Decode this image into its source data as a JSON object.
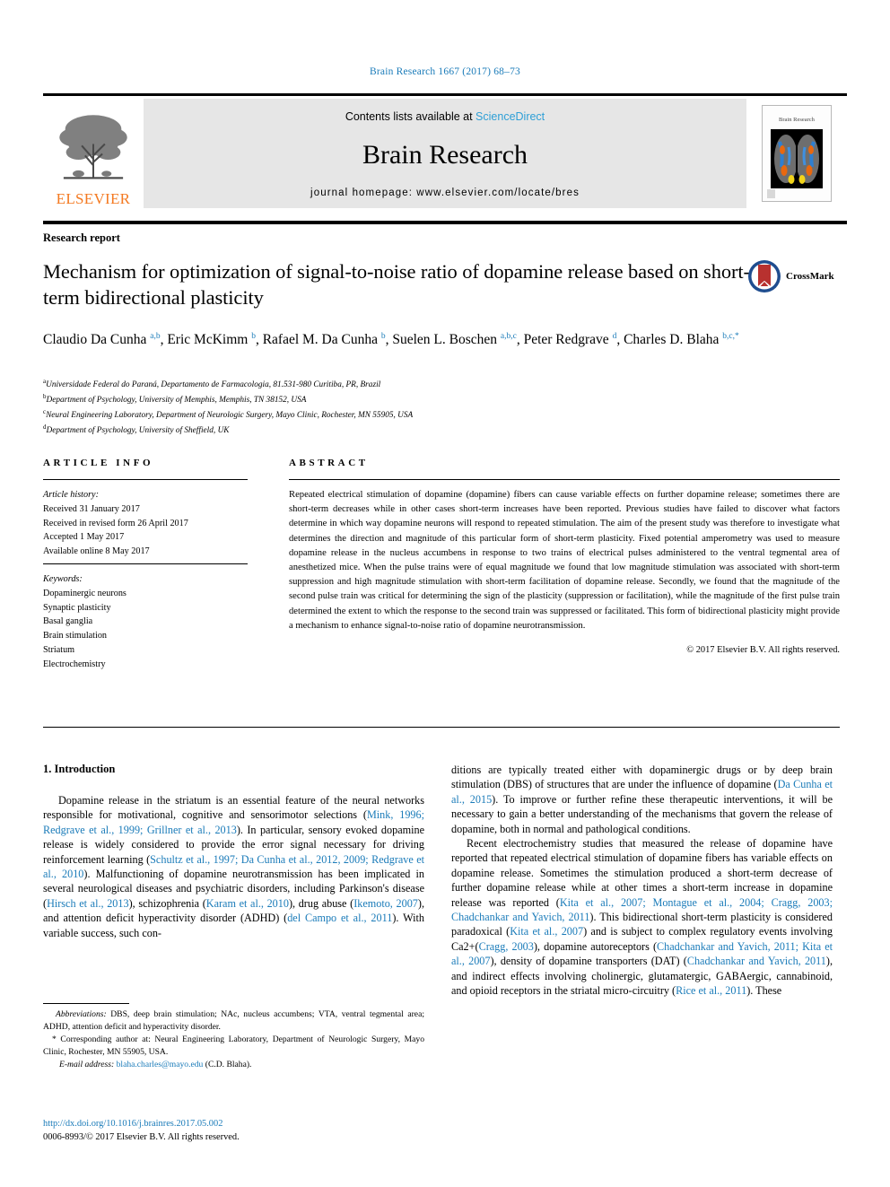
{
  "running_head": "Brain Research 1667 (2017) 68–73",
  "masthead": {
    "publisher": "ELSEVIER",
    "contents_prefix": "Contents lists available at ",
    "contents_link": "ScienceDirect",
    "journal_title": "Brain Research",
    "homepage": "journal homepage: www.elsevier.com/locate/bres",
    "cover_title": "Brain Research"
  },
  "article": {
    "section_label": "Research report",
    "title": "Mechanism for optimization of signal-to-noise ratio of dopamine release based on short-term bidirectional plasticity",
    "crossmark_label": "CrossMark",
    "authors_html": "Claudio Da Cunha <sup>a,b</sup>, Eric McKimm <sup>b</sup>, Rafael M. Da Cunha <sup>b</sup>, Suelen L. Boschen <sup>a,b,c</sup>, Peter Redgrave <sup>d</sup>, Charles D. Blaha <sup>b,c,</sup><sup>*</sup>",
    "affiliations": [
      {
        "marker": "a",
        "text": "Universidade Federal do Paraná, Departamento de Farmacologia, 81.531-980 Curitiba, PR, Brazil"
      },
      {
        "marker": "b",
        "text": "Department of Psychology, University of Memphis, Memphis, TN 38152, USA"
      },
      {
        "marker": "c",
        "text": "Neural Engineering Laboratory, Department of Neurologic Surgery, Mayo Clinic, Rochester, MN 55905, USA"
      },
      {
        "marker": "d",
        "text": "Department of Psychology, University of Sheffield, UK"
      }
    ]
  },
  "article_info": {
    "heading": "ARTICLE INFO",
    "history_label": "Article history:",
    "history": [
      "Received 31 January 2017",
      "Received in revised form 26 April 2017",
      "Accepted 1 May 2017",
      "Available online 8 May 2017"
    ],
    "keywords_label": "Keywords:",
    "keywords": [
      "Dopaminergic neurons",
      "Synaptic plasticity",
      "Basal ganglia",
      "Brain stimulation",
      "Striatum",
      "Electrochemistry"
    ]
  },
  "abstract": {
    "heading": "ABSTRACT",
    "text": "Repeated electrical stimulation of dopamine (dopamine) fibers can cause variable effects on further dopamine release; sometimes there are short-term decreases while in other cases short-term increases have been reported. Previous studies have failed to discover what factors determine in which way dopamine neurons will respond to repeated stimulation. The aim of the present study was therefore to investigate what determines the direction and magnitude of this particular form of short-term plasticity. Fixed potential amperometry was used to measure dopamine release in the nucleus accumbens in response to two trains of electrical pulses administered to the ventral tegmental area of anesthetized mice. When the pulse trains were of equal magnitude we found that low magnitude stimulation was associated with short-term suppression and high magnitude stimulation with short-term facilitation of dopamine release. Secondly, we found that the magnitude of the second pulse train was critical for determining the sign of the plasticity (suppression or facilitation), while the magnitude of the first pulse train determined the extent to which the response to the second train was suppressed or facilitated. This form of bidirectional plasticity might provide a mechanism to enhance signal-to-noise ratio of dopamine neurotransmission.",
    "copyright": "© 2017 Elsevier B.V. All rights reserved."
  },
  "body": {
    "intro_heading": "1. Introduction",
    "left_column_html": "<p>Dopamine release in the striatum is an essential feature of the neural networks responsible for motivational, cognitive and sensorimotor selections (<span class=\"cite\">Mink, 1996; Redgrave et al., 1999; Grillner et al., 2013</span>). In particular, sensory evoked dopamine release is widely considered to provide the error signal necessary for driving reinforcement learning (<span class=\"cite\">Schultz et al., 1997; Da Cunha et al., 2012, 2009; Redgrave et al., 2010</span>). Malfunctioning of dopamine neurotransmission has been implicated in several neurological diseases and psychiatric disorders, including Parkinson's disease (<span class=\"cite\">Hirsch et al., 2013</span>), schizophrenia (<span class=\"cite\">Karam et al., 2010</span>), drug abuse (<span class=\"cite\">Ikemoto, 2007</span>), and attention deficit hyperactivity disorder (ADHD) (<span class=\"cite\">del Campo et al., 2011</span>). With variable success, such con-</p>",
    "right_column_html": "<p class=\"noindent\">ditions are typically treated either with dopaminergic drugs or by deep brain stimulation (DBS) of structures that are under the influence of dopamine (<span class=\"cite\">Da Cunha et al., 2015</span>). To improve or further refine these therapeutic interventions, it will be necessary to gain a better understanding of the mechanisms that govern the release of dopamine, both in normal and pathological conditions.</p><p>Recent electrochemistry studies that measured the release of dopamine have reported that repeated electrical stimulation of dopamine fibers has variable effects on dopamine release. Sometimes the stimulation produced a short-term decrease of further dopamine release while at other times a short-term increase in dopamine release was reported (<span class=\"cite\">Kita et al., 2007; Montague et al., 2004; Cragg, 2003; Chadchankar and Yavich, 2011</span>). This bidirectional short-term plasticity is considered paradoxical (<span class=\"cite\">Kita et al., 2007</span>) and is subject to complex regulatory events involving Ca2+(<span class=\"cite\">Cragg, 2003</span>), dopamine autoreceptors (<span class=\"cite\">Chadchankar and Yavich, 2011; Kita et al., 2007</span>), density of dopamine transporters (DAT) (<span class=\"cite\">Chadchankar and Yavich, 2011</span>), and indirect effects involving cholinergic, glutamatergic, GABAergic, cannabinoid, and opioid receptors in the striatal micro-circuitry (<span class=\"cite\">Rice et al., 2011</span>). These</p>"
  },
  "footnotes": {
    "abbreviations_html": "<span class=\"ital\">Abbreviations:</span> DBS, deep brain stimulation; NAc, nucleus accumbens; VTA, ventral tegmental area; ADHD, attention deficit and hyperactivity disorder.",
    "corresponding_html": "* Corresponding author at: Neural Engineering Laboratory, Department of Neurologic Surgery, Mayo Clinic, Rochester, MN 55905, USA.",
    "email_html": "<span class=\"ital\">E-mail address:</span> <span class=\"doi-link\">blaha.charles@mayo.edu</span> (C.D. Blaha)."
  },
  "doi": {
    "url": "http://dx.doi.org/10.1016/j.brainres.2017.05.002",
    "issn_line": "0006-8993/© 2017 Elsevier B.V. All rights reserved."
  },
  "colors": {
    "link_blue": "#1a7bb9",
    "sciencedirect_blue": "#2e9fd6",
    "elsevier_orange": "#f47920",
    "crossmark_red": "#b8312f"
  }
}
